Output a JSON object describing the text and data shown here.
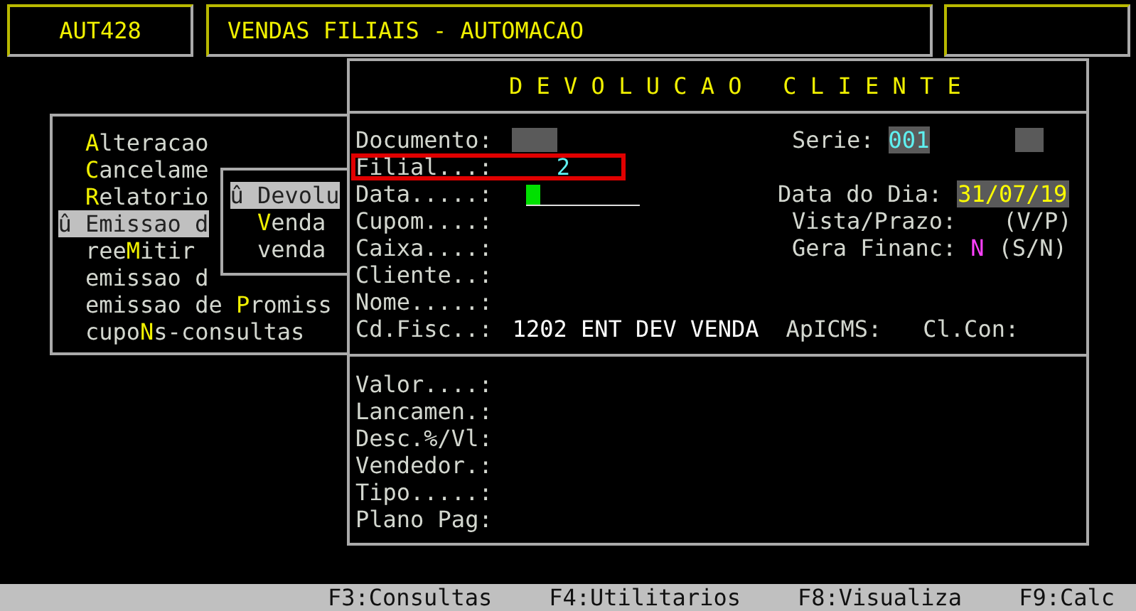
{
  "header": {
    "code": "AUT428",
    "title": "VENDAS FILIAIS - AUTOMACAO"
  },
  "menu": {
    "items": [
      {
        "label": "**A**lteracao",
        "selected": false
      },
      {
        "label": "**C**ancelame",
        "selected": false
      },
      {
        "label": "**R**elatorio",
        "selected": false
      },
      {
        "label": "û Emissao d",
        "selected": true
      },
      {
        "label": "ree**M**itir",
        "selected": false
      },
      {
        "label": "emissao d",
        "selected": false
      },
      {
        "label": "emissao de **P**romiss",
        "selected": false
      },
      {
        "label": "cupo**N**s-consultas",
        "selected": false
      }
    ]
  },
  "submenu": {
    "items": [
      {
        "label": "û Devolu",
        "selected": true
      },
      {
        "label": "**V**enda",
        "selected": false
      },
      {
        "label": "venda",
        "selected": false
      }
    ]
  },
  "dialog": {
    "title": "D E V O L U C A O   C L I E N T E",
    "rows": [
      {
        "label": "Documento:",
        "kind": "blank",
        "highlighted": false,
        "right": {
          "label": "Serie:",
          "kind": "serie",
          "value": "001"
        }
      },
      {
        "label": "Filial...:",
        "kind": "value",
        "value": "2",
        "highlighted": true
      },
      {
        "label": "Data.....:",
        "kind": "cursor",
        "highlighted": false,
        "right": {
          "label": "Data do Dia:",
          "kind": "date",
          "value": "31/07/19"
        }
      },
      {
        "label": "Cupom....:",
        "kind": "none",
        "highlighted": false,
        "right": {
          "label": "Vista/Prazo:",
          "kind": "hint",
          "hint": "(V/P)"
        }
      },
      {
        "label": "Caixa....:",
        "kind": "none",
        "highlighted": false,
        "right": {
          "label": "Gera Financ:",
          "kind": "flag",
          "value": "N",
          "hint": "(S/N)"
        }
      },
      {
        "label": "Cliente..:",
        "kind": "none",
        "highlighted": false
      },
      {
        "label": "Nome.....:",
        "kind": "none",
        "highlighted": false
      },
      {
        "label": "Cd.Fisc..:",
        "kind": "text",
        "value": "1202 ENT DEV VENDA",
        "highlighted": false,
        "extras": [
          "ApICMS:",
          "Cl.Con:"
        ]
      }
    ],
    "lower": [
      "Valor....:",
      "Lancamen.:",
      "Desc.%/Vl:",
      "Vendedor.:",
      "Tipo.....:",
      "Plano Pag:"
    ]
  },
  "status_bar": [
    "F3:Consultas",
    "F4:Utilitarios",
    "F8:Visualiza",
    "F9:Calc"
  ]
}
